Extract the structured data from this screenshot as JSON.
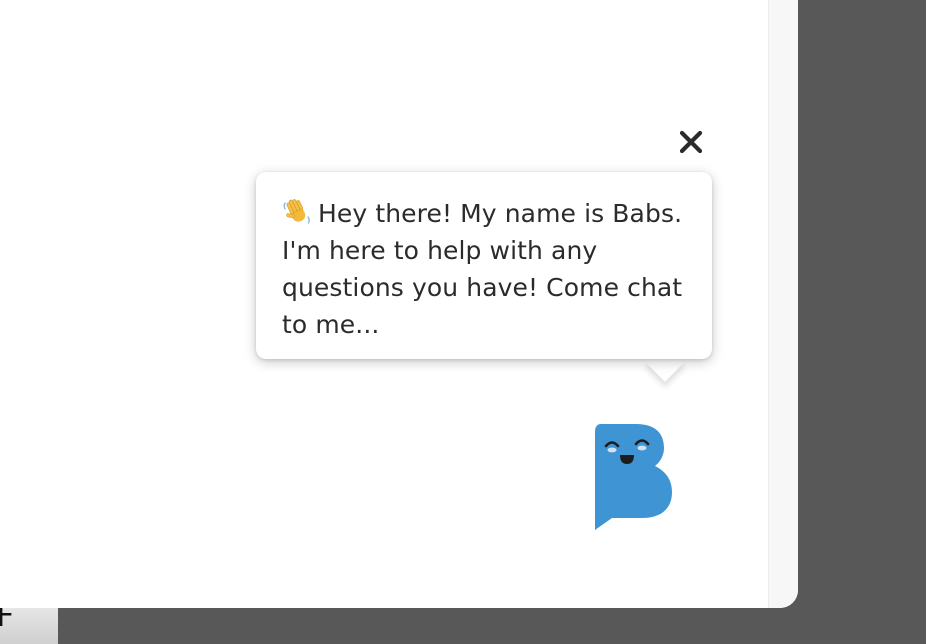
{
  "chat_widget": {
    "greeting": "Hey there! My name is Babs. I'm here to help with any questions you have! Come chat to me...",
    "greeting_icon": "waving-hand-icon",
    "close_icon": "close-icon",
    "avatar_icon": "babs-chat-bot-icon",
    "avatar_color": "#3f95d4"
  },
  "colors": {
    "page_background": "#ffffff",
    "desktop_background": "#585858",
    "text": "#2b2b2b"
  }
}
